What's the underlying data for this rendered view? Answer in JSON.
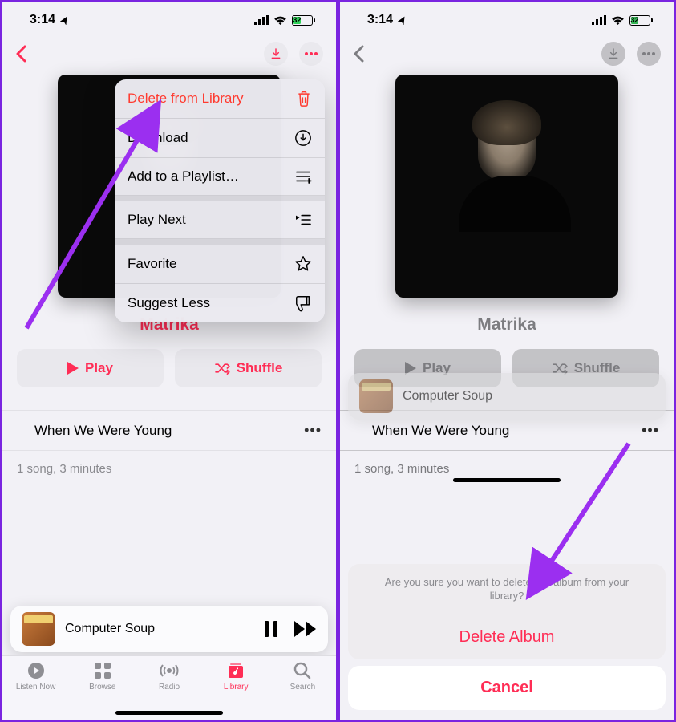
{
  "status": {
    "time": "3:14",
    "battery_text": "32",
    "battery_pct": 32
  },
  "accent_color": "#ff2d55",
  "destructive_color": "#ff3b30",
  "album": {
    "title": "Matrika",
    "play_label": "Play",
    "shuffle_label": "Shuffle",
    "tracks": [
      {
        "title": "When We Were Young"
      }
    ],
    "meta": "1 song, 3 minutes"
  },
  "mini_player": {
    "title": "Computer Soup"
  },
  "tabs": [
    {
      "id": "listen-now",
      "label": "Listen Now"
    },
    {
      "id": "browse",
      "label": "Browse"
    },
    {
      "id": "radio",
      "label": "Radio"
    },
    {
      "id": "library",
      "label": "Library",
      "active": true
    },
    {
      "id": "search",
      "label": "Search"
    }
  ],
  "context_menu": [
    {
      "id": "delete-library",
      "label": "Delete from Library",
      "destructive": true,
      "icon": "trash"
    },
    {
      "id": "download",
      "label": "Download",
      "icon": "download-circle"
    },
    {
      "id": "add-playlist",
      "label": "Add to a Playlist…",
      "icon": "playlist-add"
    },
    {
      "sep": true
    },
    {
      "id": "play-next",
      "label": "Play Next",
      "icon": "queue-next"
    },
    {
      "sep": true
    },
    {
      "id": "favorite",
      "label": "Favorite",
      "icon": "star"
    },
    {
      "id": "suggest-less",
      "label": "Suggest Less",
      "icon": "thumbs-down"
    }
  ],
  "action_sheet": {
    "message": "Are you sure you want to delete this album from your library?",
    "confirm": "Delete Album",
    "cancel": "Cancel"
  }
}
